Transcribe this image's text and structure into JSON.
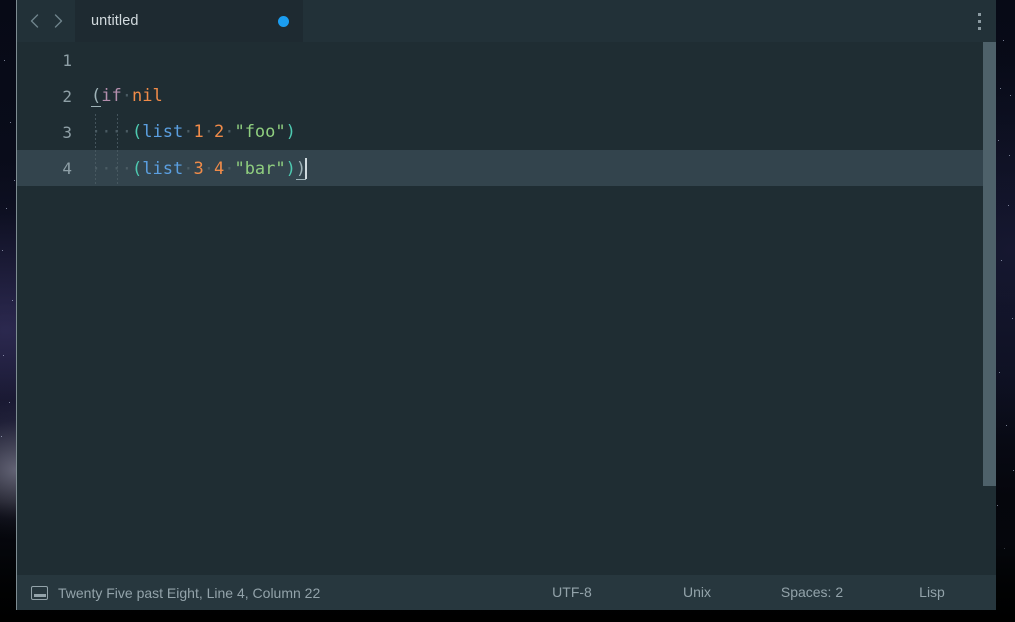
{
  "desktop": {
    "wallpaper_description": "night-sky"
  },
  "window": {
    "tabbar": {
      "back_icon": "chevron-left-icon",
      "forward_icon": "chevron-right-icon",
      "menu_icon": "kebab-menu-icon",
      "tabs": [
        {
          "title": "untitled",
          "modified": true,
          "active": true
        }
      ]
    },
    "editor": {
      "language": "Lisp",
      "cursor": {
        "line": 4,
        "column": 22
      },
      "lines": [
        {
          "number": "1",
          "active": false,
          "guides": 0,
          "tokens": []
        },
        {
          "number": "2",
          "active": false,
          "guides": 0,
          "tokens": [
            {
              "text": "(",
              "kind": "paren-match"
            },
            {
              "text": "if",
              "kind": "keyword"
            },
            {
              "text": "·",
              "kind": "space-dot"
            },
            {
              "text": "nil",
              "kind": "constant"
            }
          ]
        },
        {
          "number": "3",
          "active": false,
          "guides": 2,
          "tokens": [
            {
              "text": "·",
              "kind": "space-dot"
            },
            {
              "text": "·",
              "kind": "space-dot"
            },
            {
              "text": "·",
              "kind": "space-dot"
            },
            {
              "text": "·",
              "kind": "space-dot"
            },
            {
              "text": "(",
              "kind": "paren"
            },
            {
              "text": "list",
              "kind": "function"
            },
            {
              "text": "·",
              "kind": "space-dot"
            },
            {
              "text": "1",
              "kind": "number"
            },
            {
              "text": "·",
              "kind": "space-dot"
            },
            {
              "text": "2",
              "kind": "number"
            },
            {
              "text": "·",
              "kind": "space-dot"
            },
            {
              "text": "\"foo\"",
              "kind": "string"
            },
            {
              "text": ")",
              "kind": "paren"
            }
          ]
        },
        {
          "number": "4",
          "active": true,
          "guides": 2,
          "tokens": [
            {
              "text": "·",
              "kind": "space-dot"
            },
            {
              "text": "·",
              "kind": "space-dot"
            },
            {
              "text": "·",
              "kind": "space-dot"
            },
            {
              "text": "·",
              "kind": "space-dot"
            },
            {
              "text": "(",
              "kind": "paren"
            },
            {
              "text": "list",
              "kind": "function"
            },
            {
              "text": "·",
              "kind": "space-dot"
            },
            {
              "text": "3",
              "kind": "number"
            },
            {
              "text": "·",
              "kind": "space-dot"
            },
            {
              "text": "4",
              "kind": "number"
            },
            {
              "text": "·",
              "kind": "space-dot"
            },
            {
              "text": "\"bar\"",
              "kind": "string"
            },
            {
              "text": ")",
              "kind": "paren"
            },
            {
              "text": ")",
              "kind": "paren-match"
            },
            {
              "text": "",
              "kind": "caret"
            }
          ]
        }
      ],
      "scrollbar": {
        "visible": true
      }
    },
    "statusbar": {
      "screen_icon": "monitor-icon",
      "message": "Twenty Five past Eight, Line 4, Column 22",
      "encoding": "UTF-8",
      "line_ending": "Unix",
      "indentation": "Spaces: 2",
      "language": "Lisp"
    }
  },
  "colors": {
    "window_bg": "#1f2d33",
    "tabbar_bg": "#223138",
    "active_tab_bg": "#1e2a31",
    "active_line_bg": "#33444d",
    "statusbar_bg": "#27373e",
    "modified_dot": "#1b9df0",
    "scrollbar_thumb": "#4e616a",
    "paren": "#4ec9b0",
    "keyword": "#b48ead",
    "constant": "#f08b49",
    "function": "#5b9fe0",
    "number": "#f08b49",
    "string": "#8fce7f",
    "space_dot": "#4a5b63",
    "text_muted": "#93a3aa"
  }
}
